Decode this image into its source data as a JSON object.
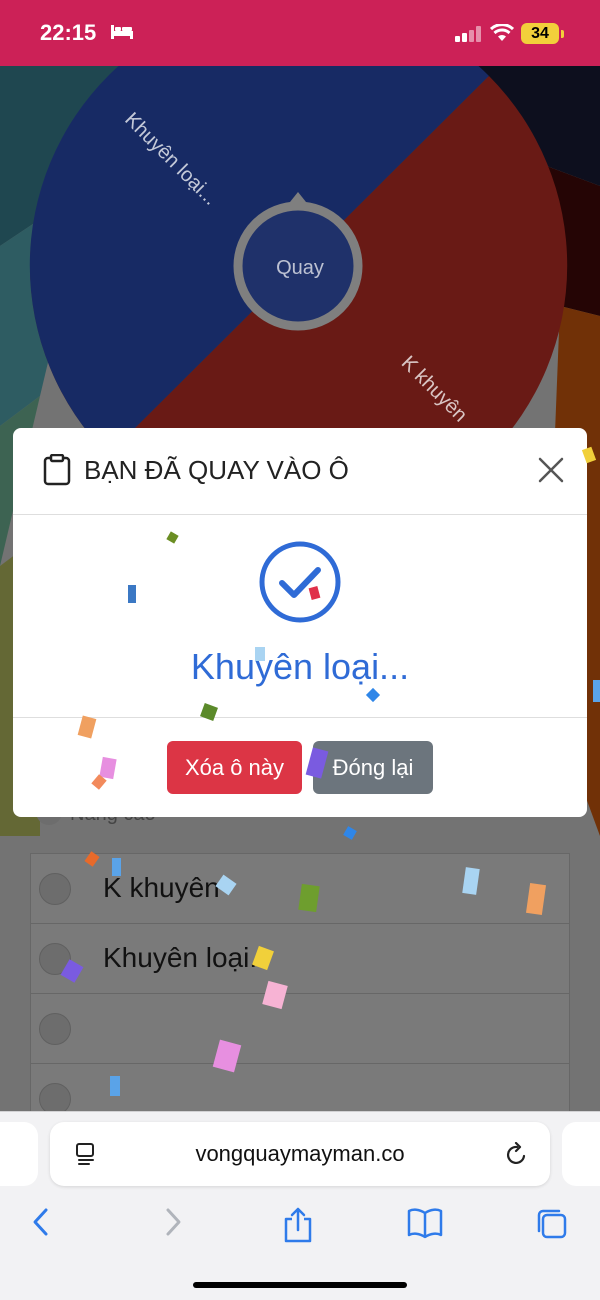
{
  "status_bar": {
    "time": "22:15",
    "battery": "34"
  },
  "wheel": {
    "center_label": "Quay",
    "segment_labels": [
      "Khuyên loại...",
      "K khuyên"
    ]
  },
  "list": {
    "partial_label": "Nâng cao",
    "items": [
      "K khuyên",
      "Khuyên loại..",
      "",
      ""
    ]
  },
  "modal": {
    "title": "BẠN ĐÃ QUAY VÀO Ô",
    "result": "Khuyên loại...",
    "delete_label": "Xóa ô này",
    "close_label": "Đóng lại"
  },
  "browser": {
    "url": "vongquaymayman.co"
  },
  "colors": {
    "status_bar": "#cc2157",
    "wheel_blue": "#2f55c9",
    "wheel_red": "#d3352a",
    "wheel_rim": "#e8591a",
    "result_blue": "#2f6bd6",
    "danger": "#dc3545",
    "secondary": "#6c757d"
  },
  "icons": [
    "bed-icon",
    "signal-icon",
    "wifi-icon",
    "clipboard-icon",
    "close-icon",
    "check-circle-icon",
    "reader-icon",
    "reload-icon",
    "back-icon",
    "forward-icon",
    "share-icon",
    "bookmarks-icon",
    "tabs-icon"
  ]
}
